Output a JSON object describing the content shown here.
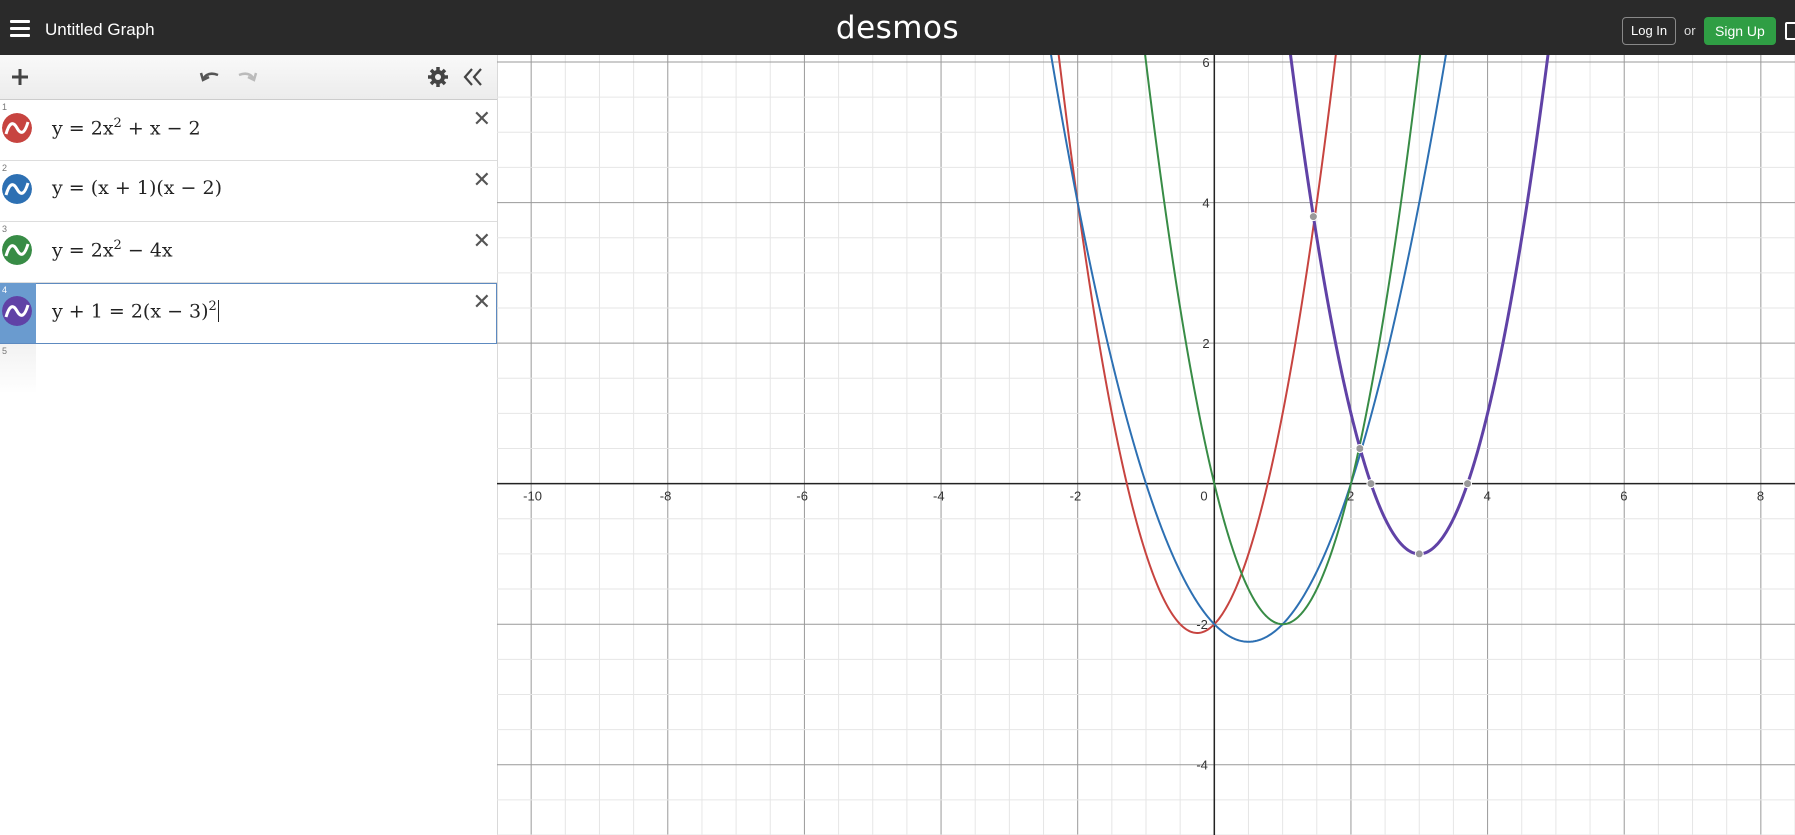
{
  "app": {
    "title": "Untitled Graph",
    "logo": "desmos"
  },
  "auth": {
    "login_label": "Log In",
    "or_label": "or",
    "signup_label": "Sign Up"
  },
  "toolbar": {
    "add_icon": "plus-icon",
    "undo_icon": "undo-icon",
    "redo_icon": "redo-icon",
    "settings_icon": "gear-icon",
    "collapse_icon": "double-chevron-left-icon"
  },
  "expressions": [
    {
      "number": "1",
      "latex_parts": [
        "y = 2x",
        "2",
        " + x − 2"
      ],
      "color": "#c74440"
    },
    {
      "number": "2",
      "latex": "y = (x + 1)(x − 2)",
      "color": "#2d70b3"
    },
    {
      "number": "3",
      "latex_parts": [
        "y = 2x",
        "2",
        " − 4x"
      ],
      "color": "#388c46"
    },
    {
      "number": "4",
      "latex_parts": [
        "y + 1 = 2(x − 3)",
        "2"
      ],
      "color": "#6042a6",
      "active": true
    },
    {
      "number": "5"
    }
  ],
  "graph": {
    "x_range": [
      -10.5,
      8.5
    ],
    "y_range": [
      -5,
      6.1
    ],
    "x_tick_labels": [
      "-10",
      "-8",
      "-6",
      "-4",
      "-2",
      "0",
      "2",
      "4",
      "6",
      "8"
    ],
    "y_tick_labels": [
      "6",
      "4",
      "2",
      "-2",
      "-4"
    ]
  },
  "colors": {
    "red": "#c74440",
    "blue": "#2d70b3",
    "green": "#388c46",
    "purple": "#6042a6",
    "topbar": "#2a2a2a",
    "signup": "#2f9e44"
  }
}
